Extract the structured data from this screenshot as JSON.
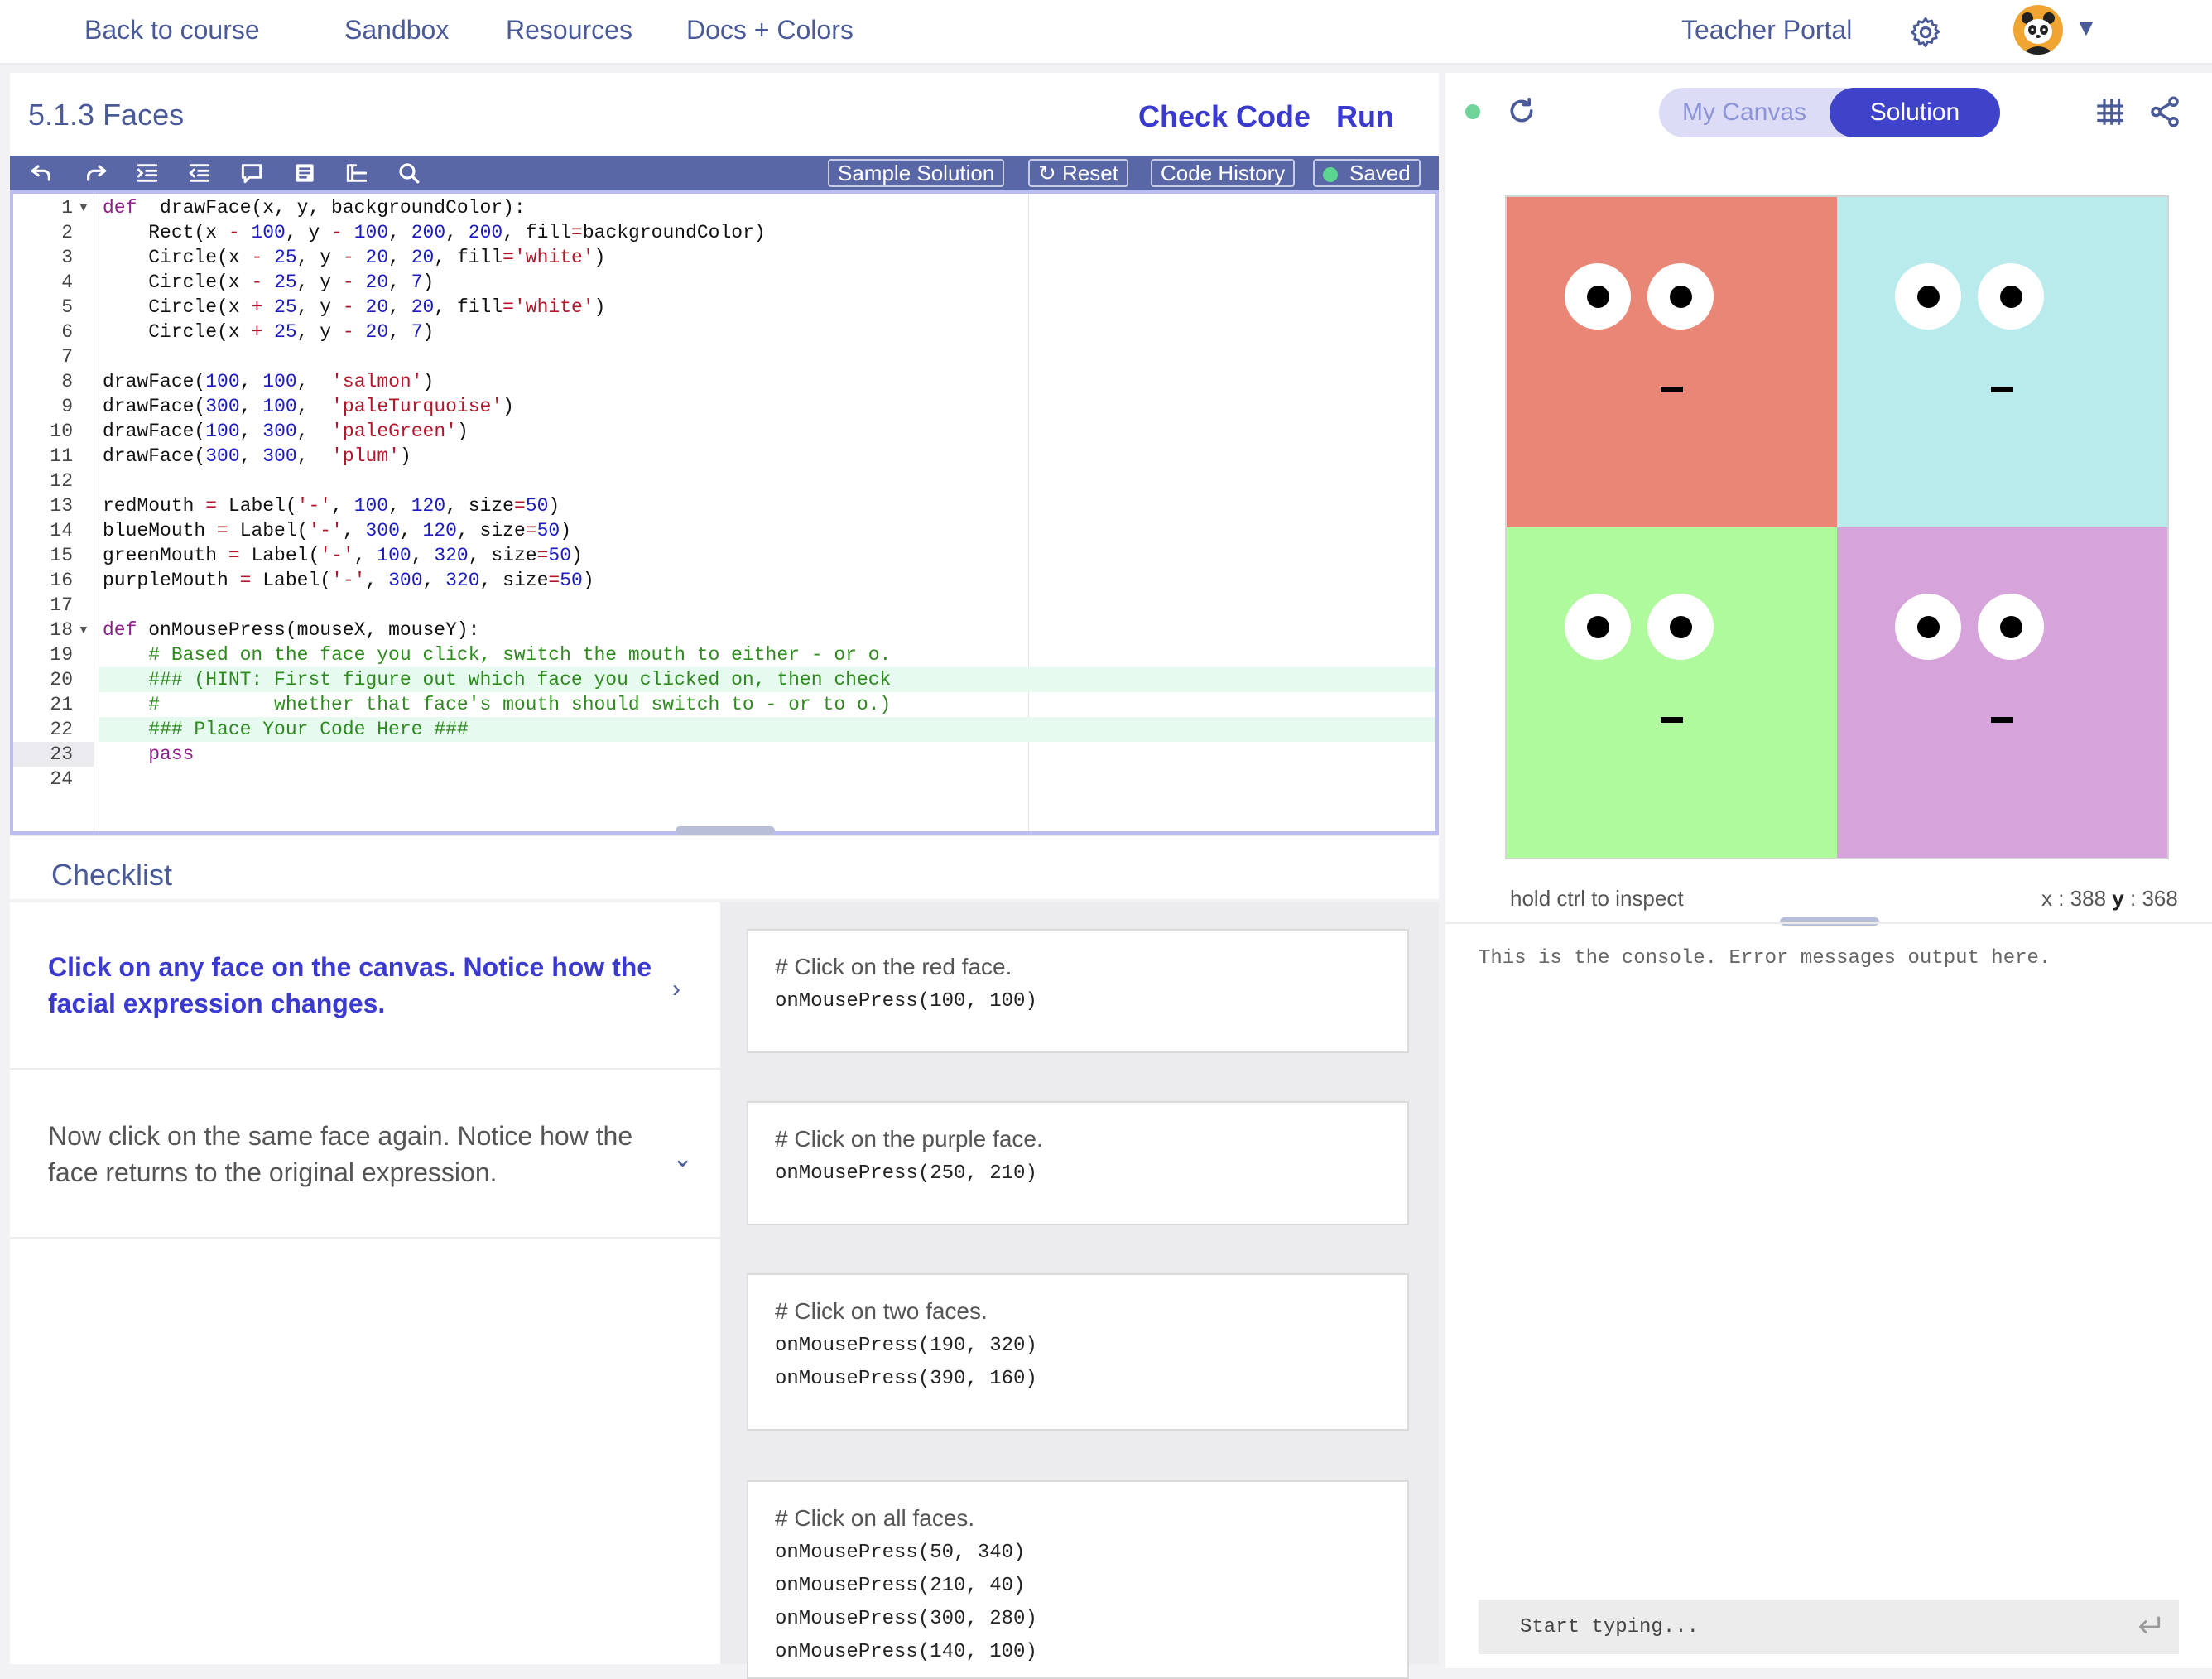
{
  "nav": {
    "back": "Back to course",
    "sandbox": "Sandbox",
    "resources": "Resources",
    "docs": "Docs + Colors",
    "teacher_portal": "Teacher Portal"
  },
  "header": {
    "title": "5.1.3 Faces",
    "check_code": "Check Code",
    "run": "Run"
  },
  "toolbar": {
    "icons": [
      "undo-icon",
      "redo-icon",
      "indent-icon",
      "outdent-icon",
      "comment-icon",
      "format-icon",
      "outline-icon",
      "search-icon"
    ],
    "sample_solution": "Sample Solution",
    "reset": "Reset",
    "code_history": "Code History",
    "saved": "Saved"
  },
  "editor": {
    "active_line": 23,
    "highlighted_lines": [
      20,
      22
    ],
    "fold_lines": [
      1,
      18
    ],
    "lines": [
      [
        [
          "kw",
          "def"
        ],
        [
          "",
          "  drawFace(x, y, backgroundColor):"
        ]
      ],
      [
        [
          "",
          "    Rect(x "
        ],
        [
          "op",
          "-"
        ],
        [
          "",
          " "
        ],
        [
          "num",
          "100"
        ],
        [
          "",
          ", y "
        ],
        [
          "op",
          "-"
        ],
        [
          "",
          " "
        ],
        [
          "num",
          "100"
        ],
        [
          "",
          ", "
        ],
        [
          "num",
          "200"
        ],
        [
          "",
          ", "
        ],
        [
          "num",
          "200"
        ],
        [
          "",
          ", fill"
        ],
        [
          "op",
          "="
        ],
        [
          "",
          "backgroundColor)"
        ]
      ],
      [
        [
          "",
          "    Circle(x "
        ],
        [
          "op",
          "-"
        ],
        [
          "",
          " "
        ],
        [
          "num",
          "25"
        ],
        [
          "",
          ", y "
        ],
        [
          "op",
          "-"
        ],
        [
          "",
          " "
        ],
        [
          "num",
          "20"
        ],
        [
          "",
          ", "
        ],
        [
          "num",
          "20"
        ],
        [
          "",
          ", fill"
        ],
        [
          "op",
          "="
        ],
        [
          "str",
          "'white'"
        ],
        [
          "",
          ")"
        ]
      ],
      [
        [
          "",
          "    Circle(x "
        ],
        [
          "op",
          "-"
        ],
        [
          "",
          " "
        ],
        [
          "num",
          "25"
        ],
        [
          "",
          ", y "
        ],
        [
          "op",
          "-"
        ],
        [
          "",
          " "
        ],
        [
          "num",
          "20"
        ],
        [
          "",
          ", "
        ],
        [
          "num",
          "7"
        ],
        [
          "",
          ")"
        ]
      ],
      [
        [
          "",
          "    Circle(x "
        ],
        [
          "op",
          "+"
        ],
        [
          "",
          " "
        ],
        [
          "num",
          "25"
        ],
        [
          "",
          ", y "
        ],
        [
          "op",
          "-"
        ],
        [
          "",
          " "
        ],
        [
          "num",
          "20"
        ],
        [
          "",
          ", "
        ],
        [
          "num",
          "20"
        ],
        [
          "",
          ", fill"
        ],
        [
          "op",
          "="
        ],
        [
          "str",
          "'white'"
        ],
        [
          "",
          ")"
        ]
      ],
      [
        [
          "",
          "    Circle(x "
        ],
        [
          "op",
          "+"
        ],
        [
          "",
          " "
        ],
        [
          "num",
          "25"
        ],
        [
          "",
          ", y "
        ],
        [
          "op",
          "-"
        ],
        [
          "",
          " "
        ],
        [
          "num",
          "20"
        ],
        [
          "",
          ", "
        ],
        [
          "num",
          "7"
        ],
        [
          "",
          ")"
        ]
      ],
      [],
      [
        [
          "",
          "drawFace("
        ],
        [
          "num",
          "100"
        ],
        [
          "",
          ", "
        ],
        [
          "num",
          "100"
        ],
        [
          "",
          ",  "
        ],
        [
          "str",
          "'salmon'"
        ],
        [
          "",
          ")"
        ]
      ],
      [
        [
          "",
          "drawFace("
        ],
        [
          "num",
          "300"
        ],
        [
          "",
          ", "
        ],
        [
          "num",
          "100"
        ],
        [
          "",
          ",  "
        ],
        [
          "str",
          "'paleTurquoise'"
        ],
        [
          "",
          ")"
        ]
      ],
      [
        [
          "",
          "drawFace("
        ],
        [
          "num",
          "100"
        ],
        [
          "",
          ", "
        ],
        [
          "num",
          "300"
        ],
        [
          "",
          ",  "
        ],
        [
          "str",
          "'paleGreen'"
        ],
        [
          "",
          ")"
        ]
      ],
      [
        [
          "",
          "drawFace("
        ],
        [
          "num",
          "300"
        ],
        [
          "",
          ", "
        ],
        [
          "num",
          "300"
        ],
        [
          "",
          ",  "
        ],
        [
          "str",
          "'plum'"
        ],
        [
          "",
          ")"
        ]
      ],
      [],
      [
        [
          "",
          "redMouth "
        ],
        [
          "op",
          "="
        ],
        [
          "",
          " Label("
        ],
        [
          "str",
          "'-'"
        ],
        [
          "",
          ", "
        ],
        [
          "num",
          "100"
        ],
        [
          "",
          ", "
        ],
        [
          "num",
          "120"
        ],
        [
          "",
          ", size"
        ],
        [
          "op",
          "="
        ],
        [
          "num",
          "50"
        ],
        [
          "",
          ")"
        ]
      ],
      [
        [
          "",
          "blueMouth "
        ],
        [
          "op",
          "="
        ],
        [
          "",
          " Label("
        ],
        [
          "str",
          "'-'"
        ],
        [
          "",
          ", "
        ],
        [
          "num",
          "300"
        ],
        [
          "",
          ", "
        ],
        [
          "num",
          "120"
        ],
        [
          "",
          ", size"
        ],
        [
          "op",
          "="
        ],
        [
          "num",
          "50"
        ],
        [
          "",
          ")"
        ]
      ],
      [
        [
          "",
          "greenMouth "
        ],
        [
          "op",
          "="
        ],
        [
          "",
          " Label("
        ],
        [
          "str",
          "'-'"
        ],
        [
          "",
          ", "
        ],
        [
          "num",
          "100"
        ],
        [
          "",
          ", "
        ],
        [
          "num",
          "320"
        ],
        [
          "",
          ", size"
        ],
        [
          "op",
          "="
        ],
        [
          "num",
          "50"
        ],
        [
          "",
          ")"
        ]
      ],
      [
        [
          "",
          "purpleMouth "
        ],
        [
          "op",
          "="
        ],
        [
          "",
          " Label("
        ],
        [
          "str",
          "'-'"
        ],
        [
          "",
          ", "
        ],
        [
          "num",
          "300"
        ],
        [
          "",
          ", "
        ],
        [
          "num",
          "320"
        ],
        [
          "",
          ", size"
        ],
        [
          "op",
          "="
        ],
        [
          "num",
          "50"
        ],
        [
          "",
          ")"
        ]
      ],
      [],
      [
        [
          "kw",
          "def"
        ],
        [
          "",
          " onMousePress(mouseX, mouseY):"
        ]
      ],
      [
        [
          "cm",
          "    # Based on the face you click, switch the mouth to either - or o."
        ]
      ],
      [
        [
          "cm",
          "    ### (HINT: First figure out which face you clicked on, then check"
        ]
      ],
      [
        [
          "cm",
          "    #          whether that face's mouth should switch to - or to o.)"
        ]
      ],
      [
        [
          "cm",
          "    ### Place Your Code Here ###"
        ]
      ],
      [
        [
          "kw",
          "    pass"
        ]
      ],
      []
    ]
  },
  "checklist": {
    "title": "Checklist",
    "tasks": [
      {
        "text": "Click on any face on the canvas. Notice how the facial expression changes.",
        "chevron": "right",
        "active": true
      },
      {
        "text": "Now click on the same face again. Notice how the face returns to the original expression.",
        "chevron": "down",
        "active": false
      }
    ],
    "hints": [
      {
        "comment": "# Click on the red face.",
        "calls": [
          "onMousePress(100, 100)"
        ]
      },
      {
        "comment": "# Click on the purple face.",
        "calls": [
          "onMousePress(250, 210)"
        ]
      },
      {
        "comment": "# Click on two faces.",
        "calls": [
          "onMousePress(190, 320)",
          "onMousePress(390, 160)"
        ]
      },
      {
        "comment": "# Click on all faces.",
        "calls": [
          "onMousePress(50, 340)",
          "onMousePress(210, 40)",
          "onMousePress(300, 280)",
          "onMousePress(140, 100)"
        ]
      }
    ]
  },
  "canvas_panel": {
    "tab_my_canvas": "My Canvas",
    "tab_solution": "Solution",
    "selected_tab": "Solution",
    "faces": [
      {
        "name": "salmon",
        "color": "#ea8676"
      },
      {
        "name": "paleTurquoise",
        "color": "#b9ebed"
      },
      {
        "name": "paleGreen",
        "color": "#aefa9c"
      },
      {
        "name": "plum",
        "color": "#d6a3da"
      }
    ],
    "inspect_hint": "hold ctrl to inspect",
    "coord_x_label": "x",
    "coord_x": "388",
    "coord_y_label": "y",
    "coord_y": "368"
  },
  "console": {
    "message": "This is the console. Error messages output here.",
    "placeholder": "Start typing..."
  },
  "colors": {
    "accent": "#3f43c9",
    "nav_text": "#4a5a98",
    "toolbar": "#5a67a6",
    "status_green": "#6fd39a"
  }
}
